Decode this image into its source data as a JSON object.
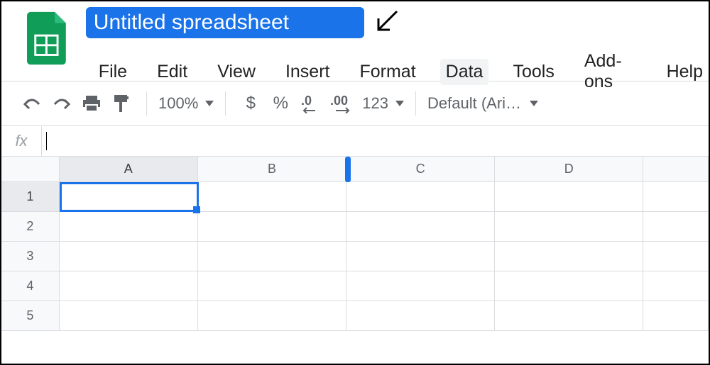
{
  "app": {
    "title": "Untitled spreadsheet"
  },
  "menu": {
    "items": [
      "File",
      "Edit",
      "View",
      "Insert",
      "Format",
      "Data",
      "Tools",
      "Add-ons",
      "Help"
    ],
    "hovered_index": 5
  },
  "toolbar": {
    "zoom": "100%",
    "currency": "$",
    "percent": "%",
    "decrease_decimal": ".0",
    "increase_decimal": ".00",
    "number_format": "123",
    "font": "Default (Ari…"
  },
  "formula_bar": {
    "label": "fx",
    "value": ""
  },
  "grid": {
    "columns": [
      "A",
      "B",
      "C",
      "D",
      ""
    ],
    "rows": [
      "1",
      "2",
      "3",
      "4",
      "5"
    ],
    "selected_cell": "A1",
    "selected_col_index": 0,
    "selected_row_index": 0
  },
  "colors": {
    "accent": "#1a73e8",
    "sheets_green": "#0f9d58"
  }
}
